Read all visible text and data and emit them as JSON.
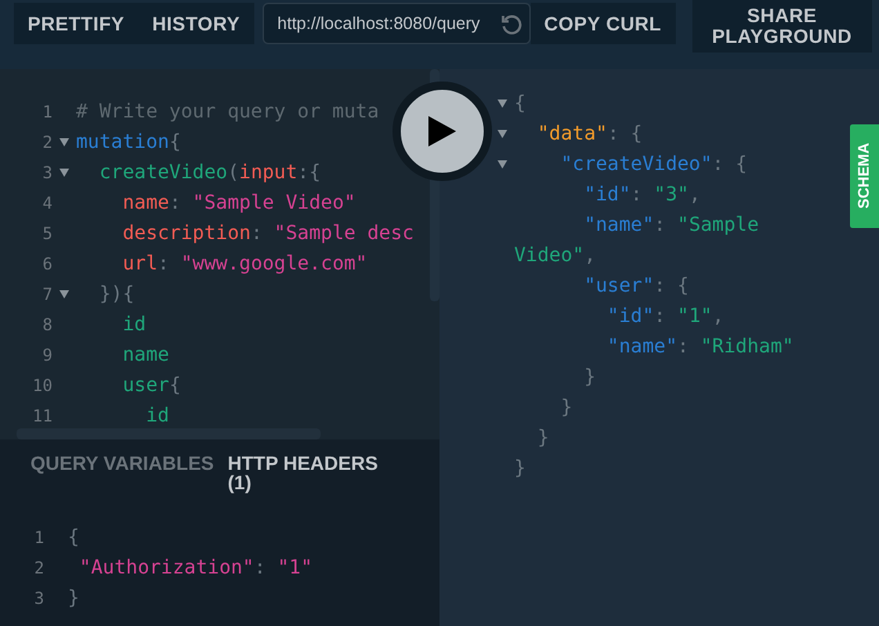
{
  "toolbar": {
    "buttons": [
      {
        "label": "PRETTIFY"
      },
      {
        "label": "HISTORY"
      }
    ],
    "url": "http://localhost:8080/query",
    "copy_button": "COPY CURL",
    "share_button": "SHARE PLAYGROUND"
  },
  "editor": {
    "lines": [
      {
        "number": "1",
        "foldable": false,
        "tokens": [
          {
            "kind": "comment",
            "text": "# Write your query or muta"
          }
        ]
      },
      {
        "number": "2",
        "foldable": true,
        "tokens": [
          {
            "kind": "keyword",
            "text": "mutation"
          },
          {
            "kind": "punct",
            "text": "{"
          }
        ]
      },
      {
        "number": "3",
        "foldable": true,
        "tokens": [
          {
            "kind": "field",
            "text": "  createVideo"
          },
          {
            "kind": "punct",
            "text": "("
          },
          {
            "kind": "arg",
            "text": "input"
          },
          {
            "kind": "punct",
            "text": ":{"
          }
        ]
      },
      {
        "number": "4",
        "foldable": false,
        "tokens": [
          {
            "kind": "arg",
            "text": "    name"
          },
          {
            "kind": "punct",
            "text": ": "
          },
          {
            "kind": "string",
            "text": "\"Sample Video\""
          }
        ]
      },
      {
        "number": "5",
        "foldable": false,
        "tokens": [
          {
            "kind": "arg",
            "text": "    description"
          },
          {
            "kind": "punct",
            "text": ": "
          },
          {
            "kind": "string",
            "text": "\"Sample desc"
          }
        ]
      },
      {
        "number": "6",
        "foldable": false,
        "tokens": [
          {
            "kind": "arg",
            "text": "    url"
          },
          {
            "kind": "punct",
            "text": ": "
          },
          {
            "kind": "string",
            "text": "\"www.google.com\""
          }
        ]
      },
      {
        "number": "7",
        "foldable": true,
        "tokens": [
          {
            "kind": "punct",
            "text": "  }){"
          }
        ]
      },
      {
        "number": "8",
        "foldable": false,
        "tokens": [
          {
            "kind": "field",
            "text": "    id"
          }
        ]
      },
      {
        "number": "9",
        "foldable": false,
        "tokens": [
          {
            "kind": "field",
            "text": "    name"
          }
        ]
      },
      {
        "number": "10",
        "foldable": false,
        "tokens": [
          {
            "kind": "field",
            "text": "    user"
          },
          {
            "kind": "punct",
            "text": "{"
          }
        ]
      },
      {
        "number": "11",
        "foldable": false,
        "tokens": [
          {
            "kind": "field",
            "text": "      id"
          }
        ]
      }
    ]
  },
  "variables": {
    "tabs": [
      {
        "label": "QUERY VARIABLES",
        "selected": false
      },
      {
        "label": "HTTP HEADERS (1)",
        "selected": true
      }
    ],
    "lines": [
      {
        "number": "1",
        "tokens": [
          {
            "kind": "punct",
            "text": "{"
          }
        ]
      },
      {
        "number": "2",
        "tokens": [
          {
            "kind": "string",
            "text": " \"Authorization\""
          },
          {
            "kind": "punct",
            "text": ": "
          },
          {
            "kind": "string",
            "text": "\"1\""
          }
        ]
      },
      {
        "number": "3",
        "tokens": [
          {
            "kind": "punct",
            "text": "}"
          }
        ]
      }
    ]
  },
  "result": {
    "lines": [
      {
        "foldable": true,
        "tokens": [
          {
            "kind": "punct",
            "text": "{"
          }
        ]
      },
      {
        "foldable": true,
        "tokens": [
          {
            "kind": "datakey",
            "text": "  \"data\""
          },
          {
            "kind": "punct",
            "text": ": {"
          }
        ]
      },
      {
        "foldable": true,
        "tokens": [
          {
            "kind": "key",
            "text": "    \"createVideo\""
          },
          {
            "kind": "punct",
            "text": ": {"
          }
        ]
      },
      {
        "foldable": false,
        "tokens": [
          {
            "kind": "key",
            "text": "      \"id\""
          },
          {
            "kind": "punct",
            "text": ": "
          },
          {
            "kind": "value",
            "text": "\"3\""
          },
          {
            "kind": "punct",
            "text": ","
          }
        ]
      },
      {
        "foldable": false,
        "tokens": [
          {
            "kind": "key",
            "text": "      \"name\""
          },
          {
            "kind": "punct",
            "text": ": "
          },
          {
            "kind": "value",
            "text": "\"Sample"
          }
        ]
      },
      {
        "foldable": false,
        "tokens": [
          {
            "kind": "value",
            "text": "Video\""
          },
          {
            "kind": "punct",
            "text": ","
          }
        ]
      },
      {
        "foldable": false,
        "tokens": [
          {
            "kind": "key",
            "text": "      \"user\""
          },
          {
            "kind": "punct",
            "text": ": {"
          }
        ]
      },
      {
        "foldable": false,
        "tokens": [
          {
            "kind": "key",
            "text": "        \"id\""
          },
          {
            "kind": "punct",
            "text": ": "
          },
          {
            "kind": "value",
            "text": "\"1\""
          },
          {
            "kind": "punct",
            "text": ","
          }
        ]
      },
      {
        "foldable": false,
        "tokens": [
          {
            "kind": "key",
            "text": "        \"name\""
          },
          {
            "kind": "punct",
            "text": ": "
          },
          {
            "kind": "value",
            "text": "\"Ridham\""
          }
        ]
      },
      {
        "foldable": false,
        "tokens": [
          {
            "kind": "punct",
            "text": "      }"
          }
        ]
      },
      {
        "foldable": false,
        "tokens": [
          {
            "kind": "punct",
            "text": "    }"
          }
        ]
      },
      {
        "foldable": false,
        "tokens": [
          {
            "kind": "punct",
            "text": "  }"
          }
        ]
      },
      {
        "foldable": false,
        "tokens": [
          {
            "kind": "punct",
            "text": "}"
          }
        ]
      }
    ]
  },
  "schema_tab": "SCHEMA"
}
